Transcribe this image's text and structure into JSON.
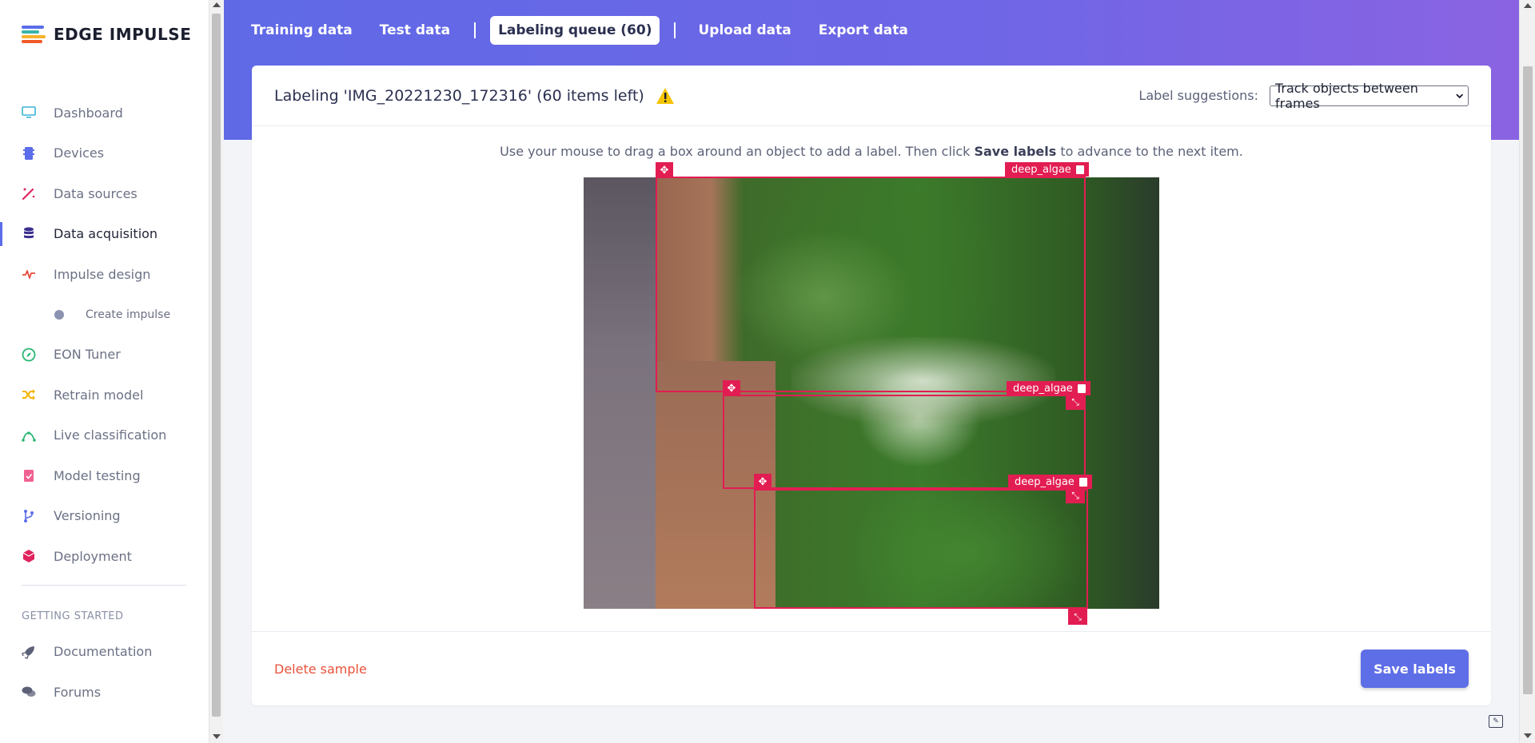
{
  "brand": {
    "name": "EDGE IMPULSE",
    "logo_colors": [
      "#f05a28",
      "#f8b22a",
      "#3ab4a8",
      "#5b6de8"
    ]
  },
  "sidebar": {
    "items": [
      {
        "label": "Dashboard",
        "icon": "monitor-icon",
        "color": "#3ab4d8"
      },
      {
        "label": "Devices",
        "icon": "chip-icon",
        "color": "#5b6de8"
      },
      {
        "label": "Data sources",
        "icon": "wand-icon",
        "color": "#e0245e"
      },
      {
        "label": "Data acquisition",
        "icon": "database-icon",
        "color": "#3b2f8f",
        "active": true
      },
      {
        "label": "Impulse design",
        "icon": "pulse-icon",
        "color": "#e84a3c"
      },
      {
        "label": "EON Tuner",
        "icon": "compass-icon",
        "color": "#2bb673"
      },
      {
        "label": "Retrain model",
        "icon": "shuffle-icon",
        "color": "#f5b400"
      },
      {
        "label": "Live classification",
        "icon": "graph-icon",
        "color": "#2bb673"
      },
      {
        "label": "Model testing",
        "icon": "clipboard-check-icon",
        "color": "#f06292"
      },
      {
        "label": "Versioning",
        "icon": "branch-icon",
        "color": "#5b6de8"
      },
      {
        "label": "Deployment",
        "icon": "cube-icon",
        "color": "#e0245e"
      }
    ],
    "sub_item": {
      "label": "Create impulse"
    },
    "section_heading": "GETTING STARTED",
    "footer_items": [
      {
        "label": "Documentation",
        "icon": "rocket-icon"
      },
      {
        "label": "Forums",
        "icon": "comments-icon"
      }
    ]
  },
  "tabs": {
    "training": "Training data",
    "test": "Test data",
    "queue": "Labeling queue (60)",
    "upload": "Upload data",
    "export": "Export data"
  },
  "card": {
    "title": "Labeling 'IMG_20221230_172316' (60 items left)",
    "suggestions_label": "Label suggestions:",
    "suggestions_value": "Track objects between frames",
    "instructions_pre": "Use your mouse to drag a box around an object to add a label. Then click ",
    "instructions_bold": "Save labels",
    "instructions_post": " to advance to the next item.",
    "boxes": [
      {
        "label": "deep_algae"
      },
      {
        "label": "deep_algae"
      },
      {
        "label": "deep_algae"
      }
    ],
    "delete_label": "Delete sample",
    "save_label": "Save labels"
  },
  "colors": {
    "accent": "#5e6ee6",
    "box": "#e21d52",
    "danger": "#e9523a",
    "warning": "#f5c400"
  }
}
